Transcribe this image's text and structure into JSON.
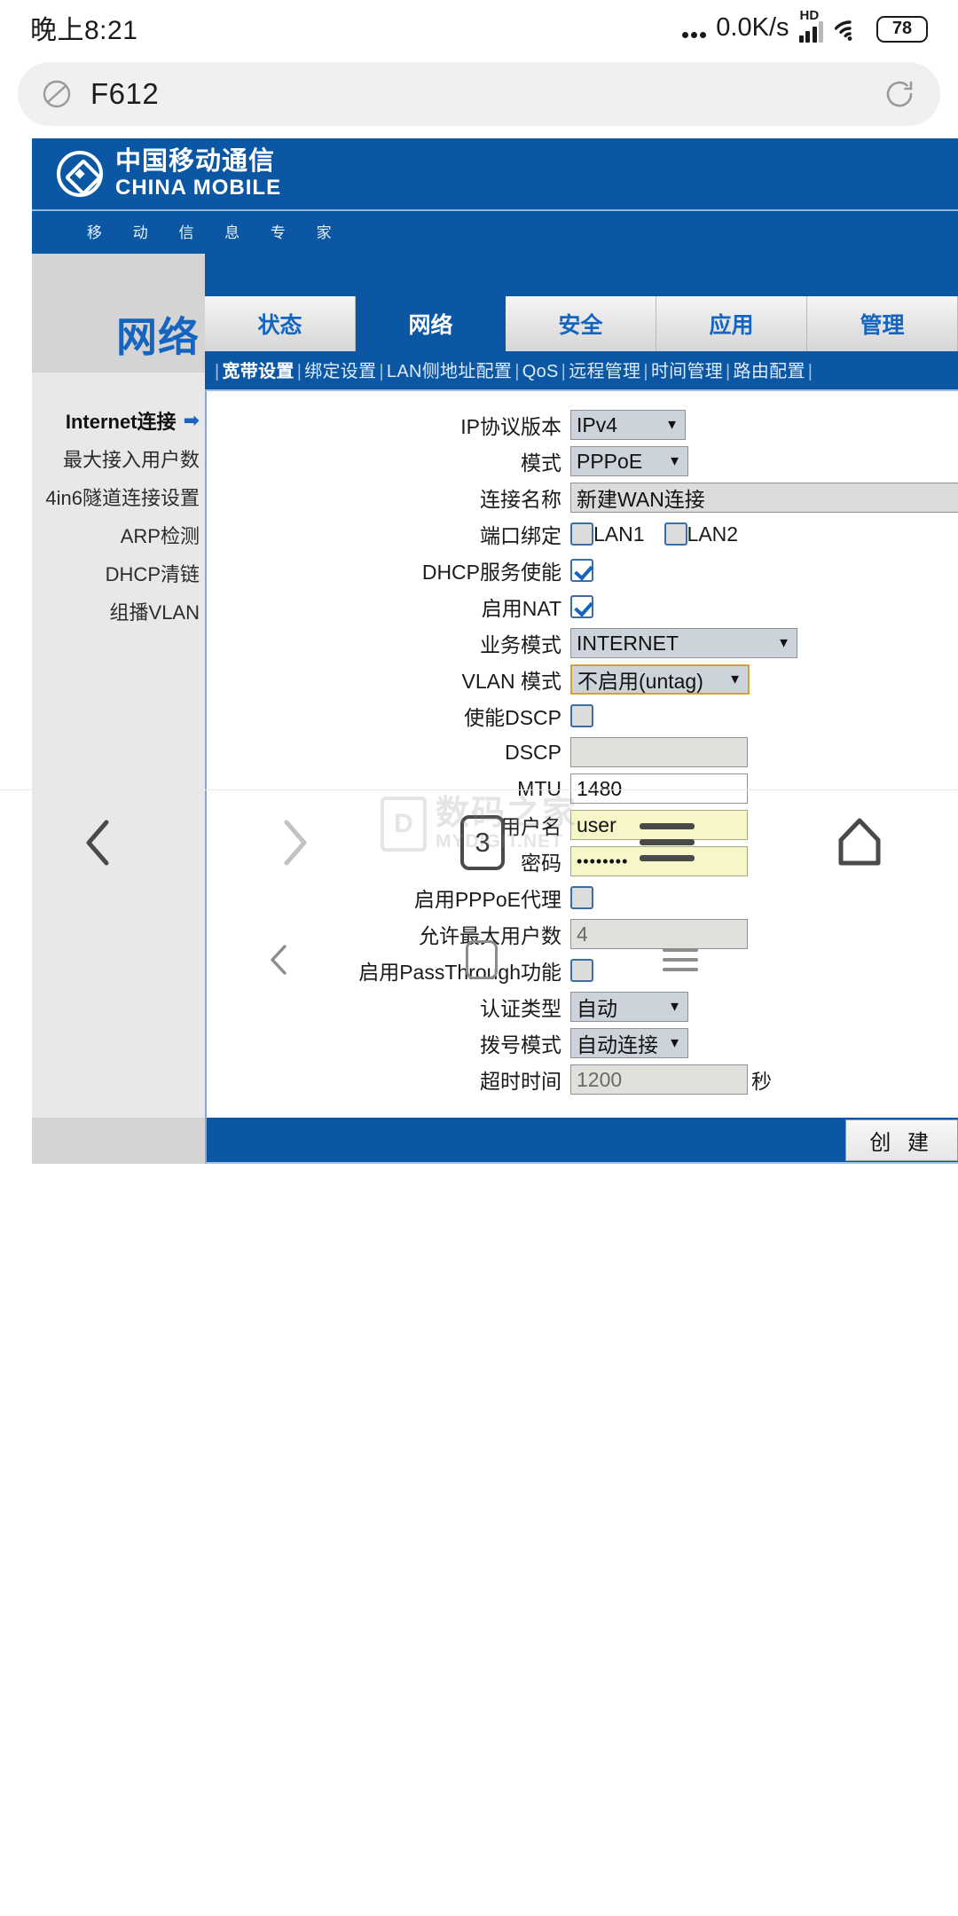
{
  "status_bar": {
    "time": "晚上8:21",
    "net_speed": "0.0K/s",
    "hd_label": "HD",
    "battery": "78"
  },
  "browser": {
    "url_text": "F612",
    "globe_icon": "globe-icon",
    "reload_icon": "reload-icon",
    "nav": {
      "back_icon": "chevron-left-icon",
      "forward_icon": "chevron-right-icon",
      "tab_count": "3",
      "menu_icon": "hamburger-icon",
      "home_icon": "home-icon"
    }
  },
  "watermark": {
    "logo_letter": "D",
    "cn": "数码之家",
    "en": "MYDIGIT.NET"
  },
  "system_nav": {
    "back_icon": "chevron-left-icon",
    "home_icon": "square-icon",
    "recents_icon": "hamburger-icon"
  },
  "router": {
    "brand": {
      "cn": "中国移动通信",
      "en": "CHINA MOBILE",
      "slogan": "移 动 信 息 专 家",
      "logo_icon": "china-mobile-logo"
    },
    "sidebar": {
      "title": "网络",
      "items": [
        {
          "label": "Internet连接",
          "active": true
        },
        {
          "label": "最大接入用户数",
          "active": false
        },
        {
          "label": "4in6隧道连接设置",
          "active": false
        },
        {
          "label": "ARP检测",
          "active": false
        },
        {
          "label": "DHCP清链",
          "active": false
        },
        {
          "label": "组播VLAN",
          "active": false
        }
      ]
    },
    "tabs": [
      {
        "label": "状态",
        "active": false
      },
      {
        "label": "网络",
        "active": true
      },
      {
        "label": "安全",
        "active": false
      },
      {
        "label": "应用",
        "active": false
      },
      {
        "label": "管理",
        "active": false
      }
    ],
    "submenu": [
      {
        "label": "宽带设置",
        "active": true
      },
      {
        "label": "绑定设置",
        "active": false
      },
      {
        "label": "LAN侧地址配置",
        "active": false
      },
      {
        "label": "QoS",
        "active": false
      },
      {
        "label": "远程管理",
        "active": false
      },
      {
        "label": "时间管理",
        "active": false
      },
      {
        "label": "路由配置",
        "active": false
      }
    ],
    "form": {
      "ip_version": {
        "label": "IP协议版本",
        "value": "IPv4"
      },
      "mode": {
        "label": "模式",
        "value": "PPPoE"
      },
      "conn_name": {
        "label": "连接名称",
        "value": "新建WAN连接"
      },
      "port_bind": {
        "label": "端口绑定",
        "lan1": "LAN1",
        "lan1_checked": false,
        "lan2": "LAN2",
        "lan2_checked": false
      },
      "dhcp_service": {
        "label": "DHCP服务使能",
        "checked": true
      },
      "enable_nat": {
        "label": "启用NAT",
        "checked": true
      },
      "service_mode": {
        "label": "业务模式",
        "value": "INTERNET"
      },
      "vlan_mode": {
        "label": "VLAN 模式",
        "value": "不启用(untag)"
      },
      "enable_dscp": {
        "label": "使能DSCP",
        "checked": false
      },
      "dscp": {
        "label": "DSCP",
        "value": ""
      },
      "mtu": {
        "label": "MTU",
        "value": "1480"
      },
      "username": {
        "label": "用户名",
        "value": "user"
      },
      "password": {
        "label": "密码",
        "value": "••••••••"
      },
      "pppoe_proxy": {
        "label": "启用PPPoE代理",
        "checked": false
      },
      "max_users": {
        "label": "允许最大用户数",
        "value": "4"
      },
      "passthrough": {
        "label": "启用PassThrough功能",
        "checked": false
      },
      "auth_type": {
        "label": "认证类型",
        "value": "自动"
      },
      "dial_mode": {
        "label": "拨号模式",
        "value": "自动连接"
      },
      "timeout": {
        "label": "超时时间",
        "value": "1200",
        "unit": "秒"
      }
    },
    "create_button": "创 建",
    "colors": {
      "brand_blue": "#0b57a4",
      "link_blue": "#1565c0",
      "highlight_yellow": "#f6f6c8",
      "sidebar_grey": "#e8e8e8"
    }
  }
}
